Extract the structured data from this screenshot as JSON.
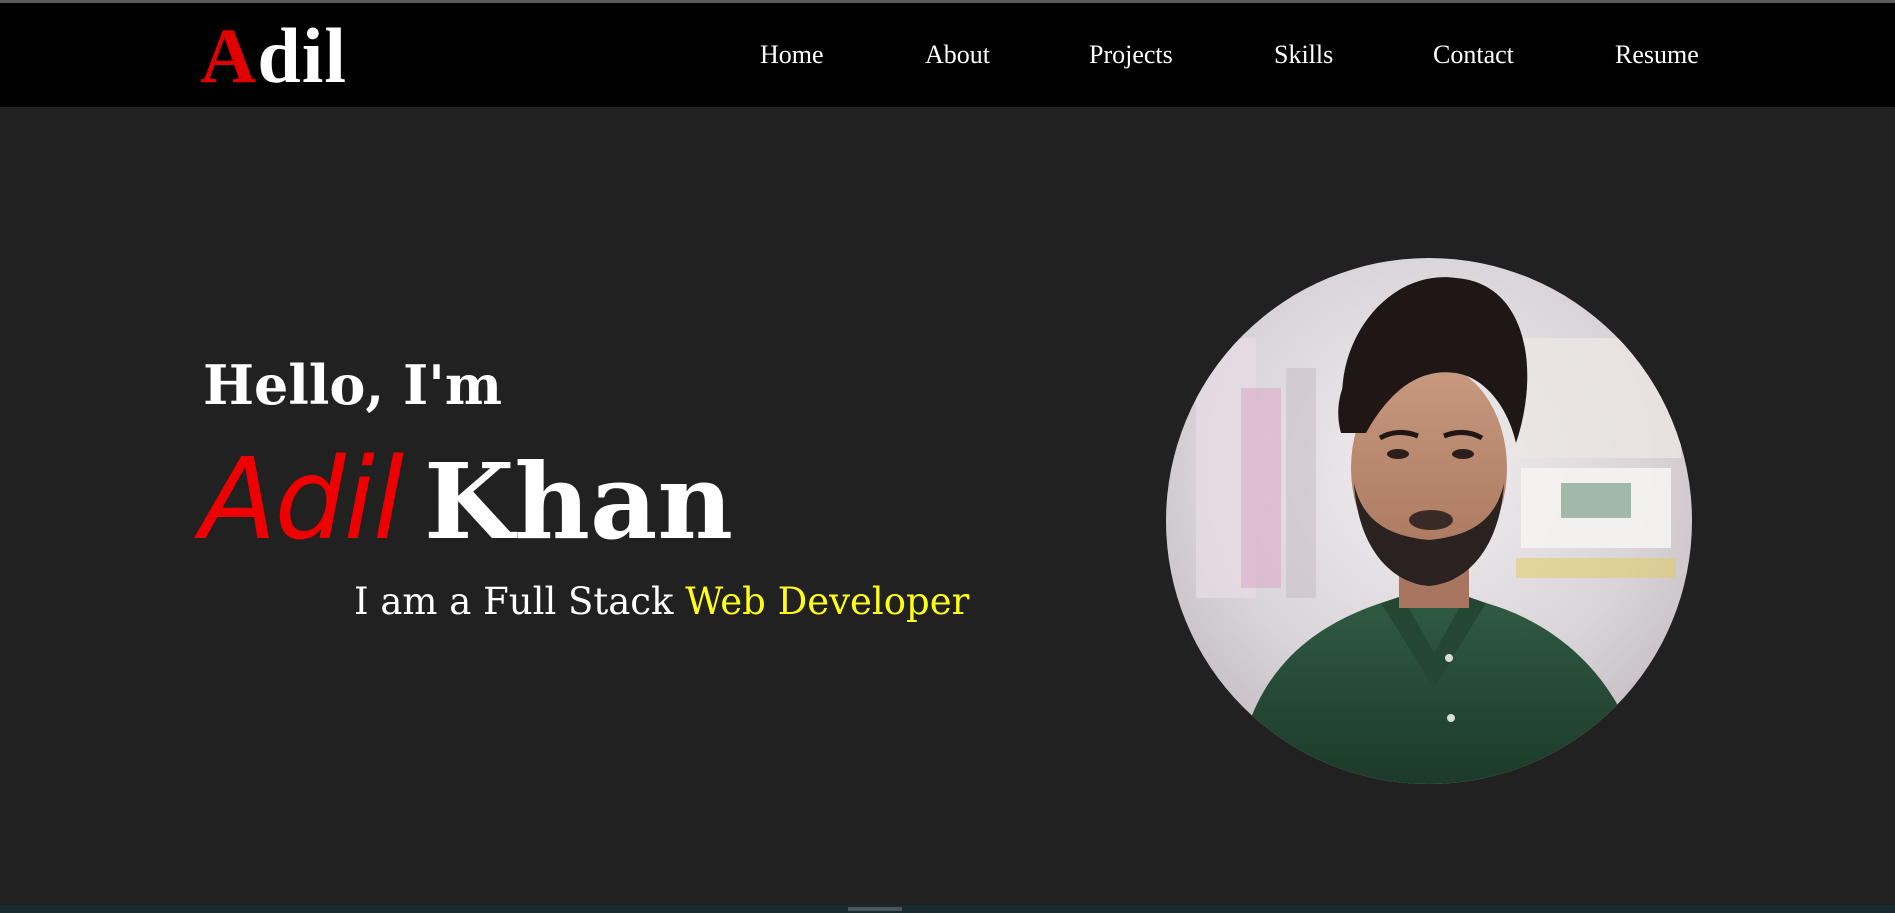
{
  "logo": {
    "first_letter": "A",
    "rest": "dil"
  },
  "nav": {
    "items": [
      {
        "label": "Home"
      },
      {
        "label": "About"
      },
      {
        "label": "Projects"
      },
      {
        "label": "Skills"
      },
      {
        "label": "Contact"
      },
      {
        "label": "Resume"
      }
    ]
  },
  "hero": {
    "greeting": "Hello, I'm",
    "first_name": "Adil",
    "last_name": "Khan",
    "subtitle_prefix": "I am a Full Stack",
    "subtitle_highlight": "Web Developer"
  },
  "colors": {
    "accent_red": "#ee0000",
    "highlight_yellow": "#ffff1a",
    "background": "#212121",
    "navbar": "#000000"
  },
  "icons": {
    "profile_photo": "profile-photo"
  }
}
